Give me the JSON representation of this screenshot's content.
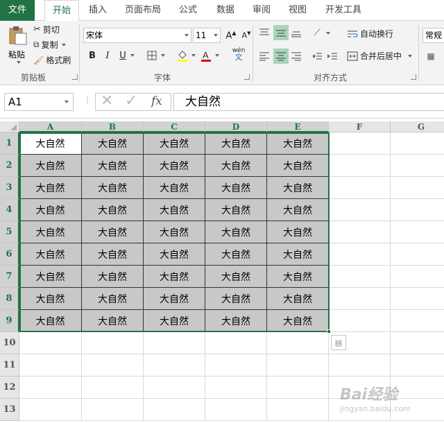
{
  "tabs": {
    "file": "文件",
    "home": "开始",
    "insert": "插入",
    "layout": "页面布局",
    "formulas": "公式",
    "data": "数据",
    "review": "审阅",
    "view": "视图",
    "developer": "开发工具"
  },
  "clipboard": {
    "paste": "粘贴",
    "cut": "剪切",
    "copy": "复制",
    "format_painter": "格式刷",
    "group": "剪贴板"
  },
  "font": {
    "name": "宋体",
    "size": "11",
    "group": "字体",
    "bold": "B",
    "italic": "I",
    "underline": "U",
    "wen": "wén",
    "wen_char": "文"
  },
  "alignment": {
    "wrap": "自动换行",
    "merge": "合并后居中",
    "group": "对齐方式"
  },
  "number": {
    "format": "常规"
  },
  "formula_bar": {
    "name_box": "A1",
    "fx": "fx",
    "content": "大自然"
  },
  "sheet": {
    "columns": [
      "A",
      "B",
      "C",
      "D",
      "E",
      "F",
      "G"
    ],
    "rows": [
      "1",
      "2",
      "3",
      "4",
      "5",
      "6",
      "7",
      "8",
      "9",
      "10",
      "11",
      "12",
      "13"
    ],
    "cell_text": "大自然"
  },
  "watermark": {
    "text": "Bai经验",
    "url": "jingyan.baidu.com"
  },
  "colors": {
    "accent": "#217346",
    "selection_fill": "#c8c8c8",
    "highlight": "#a8d5b9"
  }
}
